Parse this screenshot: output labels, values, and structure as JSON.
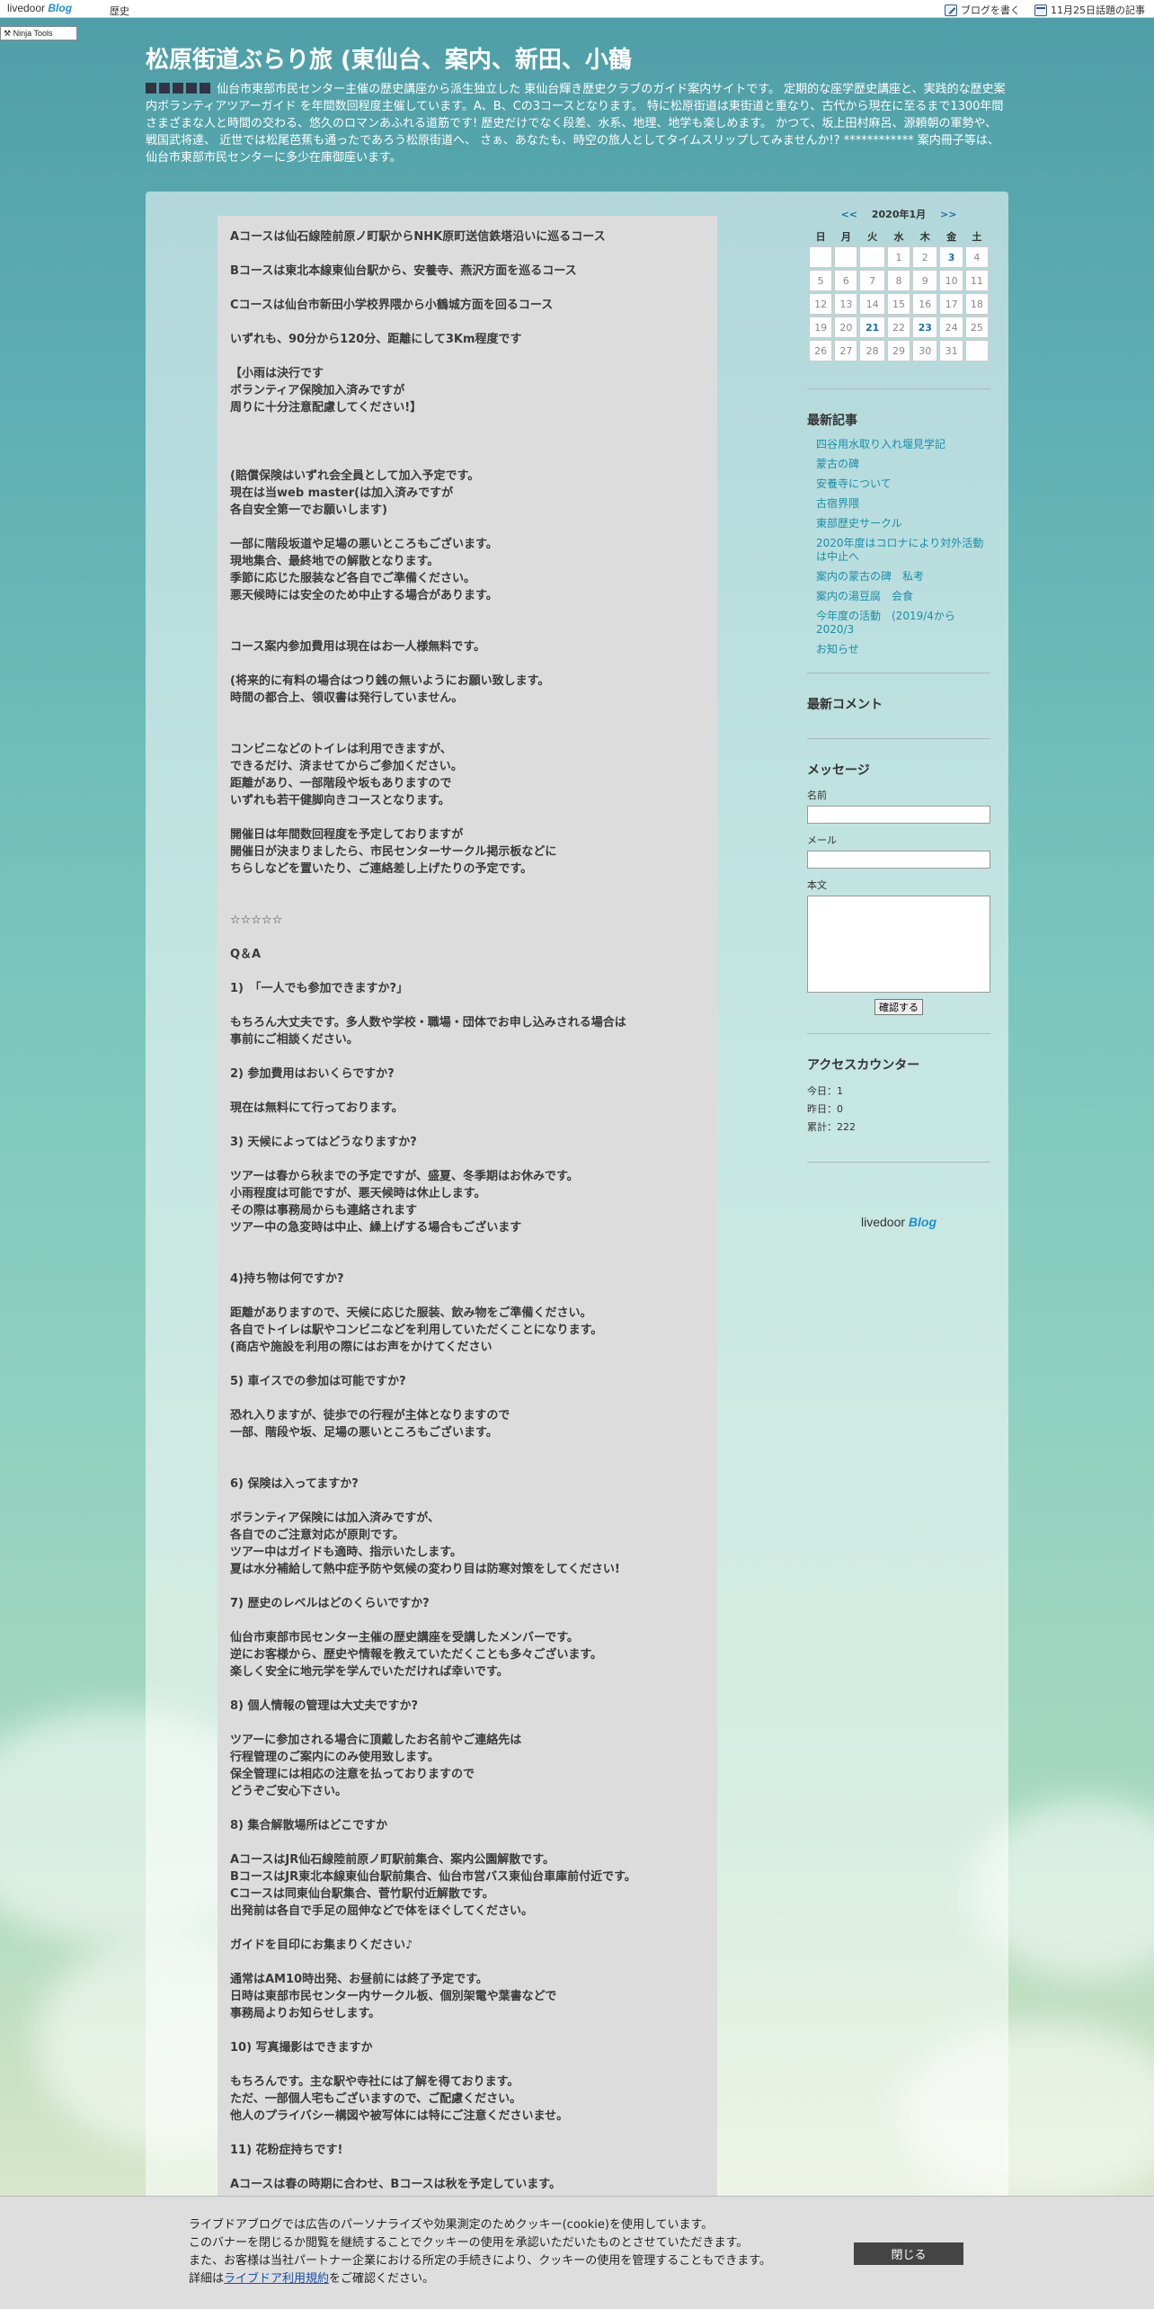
{
  "topbar": {
    "logo_text": "livedoor",
    "logo_blog": "Blog",
    "category": "歴史",
    "write_blog": "ブログを書く",
    "trending": "11月25日話題の記事"
  },
  "ninja_tools": "Ninja Tools",
  "header": {
    "title": "松原街道ぶらり旅 (東仙台、案内、新田、小鶴",
    "description": "仙台市東部市民センター主催の歴史講座から派生独立した 東仙台輝き歴史クラブのガイド案内サイトです。 定期的な座学歴史講座と、実践的な歴史案内ボランティアツアーガイド を年間数回程度主催しています。A、B、Cの3コースとなります。 特に松原街道は東街道と重なり、古代から現在に至るまで1300年間 さまざまな人と時間の交わる、悠久のロマンあふれる道筋です! 歴史だけでなく段差、水系、地理、地学も楽しめます。 かつて、坂上田村麻呂、源頼朝の軍勢や、戦国武将達、 近世では松尾芭蕉も通ったであろう松原街道へ、 さぁ、あなたも、時空の旅人としてタイムスリップしてみませんか!? ************ 案内冊子等は、仙台市東部市民センターに多少在庫御座います。"
  },
  "article": {
    "paragraphs": [
      "Aコースは仙石線陸前原ノ町駅からNHK原町送信鉄塔沿いに巡るコース",
      "",
      "Bコースは東北本線東仙台駅から、安養寺、燕沢方面を巡るコース",
      "",
      "Cコースは仙台市新田小学校界隈から小鶴城方面を回るコース",
      "",
      "いずれも、90分から120分、距離にして3Km程度です",
      "",
      "【小雨は決行です",
      "ボランティア保険加入済みですが",
      "周りに十分注意配慮してください!】",
      "",
      "",
      "",
      "(賠償保険はいずれ会全員として加入予定です。",
      "現在は当web master(は加入済みですが",
      "各自安全第一でお願いします)",
      "",
      "一部に階段坂道や足場の悪いところもございます。",
      "現地集合、最終地での解散となります。",
      "季節に応じた服装など各自でご準備ください。",
      "悪天候時には安全のため中止する場合があります。",
      "",
      "",
      "コース案内参加費用は現在はお一人様無料です。",
      "",
      "(将来的に有料の場合はつり銭の無いようにお願い致します。",
      "時間の都合上、領収書は発行していません。",
      "",
      "",
      "コンビニなどのトイレは利用できますが、",
      "できるだけ、済ませてからご参加ください。",
      "距離があり、一部階段や坂もありますので",
      "いずれも若干健脚向きコースとなります。",
      "",
      "開催日は年間数回程度を予定しておりますが",
      "開催日が決まりましたら、市民センターサークル掲示板などに",
      "ちらしなどを置いたり、ご連絡差し上げたりの予定です。",
      "",
      "",
      "☆☆☆☆☆",
      "",
      "Q＆A",
      "",
      "1)　「一人でも参加できますか?」",
      "",
      "もちろん大丈夫です。多人数や学校・職場・団体でお申し込みされる場合は",
      "事前にご相談ください。",
      "",
      "2) 参加費用はおいくらですか?",
      "",
      "現在は無料にて行っております。",
      "",
      "3) 天候によってはどうなりますか?",
      "",
      "ツアーは春から秋までの予定ですが、盛夏、冬季期はお休みです。",
      "小雨程度は可能ですが、悪天候時は休止します。",
      "その際は事務局からも連絡されます",
      "ツアー中の急変時は中止、繰上げする場合もございます",
      "",
      "",
      "4)持ち物は何ですか?",
      "",
      "距離がありますので、天候に応じた服装、飲み物をご準備ください。",
      "各自でトイレは駅やコンビニなどを利用していただくことになります。",
      "(商店や施設を利用の際にはお声をかけてください",
      "",
      "5) 車イスでの参加は可能ですか?",
      "",
      "恐れ入りますが、徒歩での行程が主体となりますので",
      "一部、階段や坂、足場の悪いところもございます。",
      "",
      "",
      "6) 保険は入ってますか?",
      "",
      "ボランティア保険には加入済みですが、",
      "各自でのご注意対応が原則です。",
      "ツアー中はガイドも適時、指示いたします。",
      "夏は水分補給して熱中症予防や気候の変わり目は防寒対策をしてください!",
      "",
      "7) 歴史のレベルはどのくらいですか?",
      "",
      "仙台市東部市民センター主催の歴史講座を受講したメンバーです。",
      "逆にお客様から、歴史や情報を教えていただくことも多々ございます。",
      "楽しく安全に地元学を学んでいただければ幸いです。",
      "",
      "8) 個人情報の管理は大丈夫ですか?",
      "",
      "ツアーに参加される場合に頂戴したお名前やご連絡先は",
      "行程管理のご案内にのみ使用致します。",
      "保全管理には相応の注意を払っておりますので",
      "どうぞご安心下さい。",
      "",
      "8) 集合解散場所はどこですか",
      "",
      "AコースはJR仙石線陸前原ノ町駅前集合、案内公園解散です。",
      "BコースはJR東北本線東仙台駅前集合、仙台市営バス東仙台車庫前付近です。",
      "Cコースは同東仙台駅集合、菅竹駅付近解散です。",
      "出発前は各自で手足の屈伸などで体をほぐしてください。",
      "",
      "ガイドを目印にお集まりください♪",
      "",
      "通常はAM10時出発、お昼前には終了予定です。",
      "日時は東部市民センター内サークル板、個別架電や葉書などで",
      "事務局よりお知らせします。",
      "",
      "10) 写真撮影はできますか",
      "",
      "もちろんです。主な駅や寺社には了解を得ております。",
      "ただ、一部個人宅もございますので、ご配慮ください。",
      "他人のプライバシー構図や被写体には特にご注意くださいませ。",
      "",
      "11) 花粉症持ちです!",
      "",
      "Aコースは春の時期に合わせ、Bコースは秋を予定しています。"
    ]
  },
  "calendar": {
    "prev": "<<",
    "month": "2020年1月",
    "next": ">>",
    "weekdays": [
      "日",
      "月",
      "火",
      "水",
      "木",
      "金",
      "土"
    ],
    "weeks": [
      [
        "",
        "",
        "",
        "1",
        "2",
        "3",
        "4"
      ],
      [
        "5",
        "6",
        "7",
        "8",
        "9",
        "10",
        "11"
      ],
      [
        "12",
        "13",
        "14",
        "15",
        "16",
        "17",
        "18"
      ],
      [
        "19",
        "20",
        "21",
        "22",
        "23",
        "24",
        "25"
      ],
      [
        "26",
        "27",
        "28",
        "29",
        "30",
        "31",
        ""
      ]
    ],
    "linked_days": [
      "3",
      "21",
      "23"
    ]
  },
  "recent_posts": {
    "heading": "最新記事",
    "items": [
      "四谷用水取り入れ堰見学記",
      "蒙古の碑",
      "安養寺について",
      "古宿界隈",
      "東部歴史サークル",
      "2020年度はコロナにより対外活動は中止へ",
      "案内の蒙古の碑　私考",
      "案内の湯豆腐　会食",
      "今年度の活動　(2019/4から2020/3",
      "お知らせ"
    ]
  },
  "recent_comments": {
    "heading": "最新コメント"
  },
  "message_form": {
    "heading": "メッセージ",
    "name_label": "名前",
    "email_label": "メール",
    "body_label": "本文",
    "submit_label": "確認する"
  },
  "access_counter": {
    "heading": "アクセスカウンター",
    "today": "今日：1",
    "yesterday": "昨日：0",
    "total": "累計：222"
  },
  "sidebar_logo": {
    "text": "livedoor",
    "blog": "Blog"
  },
  "cookie_banner": {
    "line1": "ライブドアブログでは広告のパーソナライズや効果測定のためクッキー(cookie)を使用しています。",
    "line2": "このバナーを閉じるか閲覧を継続することでクッキーの使用を承認いただいたものとさせていただきます。",
    "line3": "また、お客様は当社パートナー企業における所定の手続きにより、クッキーの使用を管理することもできます。",
    "line4_prefix": "詳細は",
    "line4_link": "ライブドア利用規約",
    "line4_suffix": "をご確認ください。",
    "close_label": "閉じる"
  }
}
